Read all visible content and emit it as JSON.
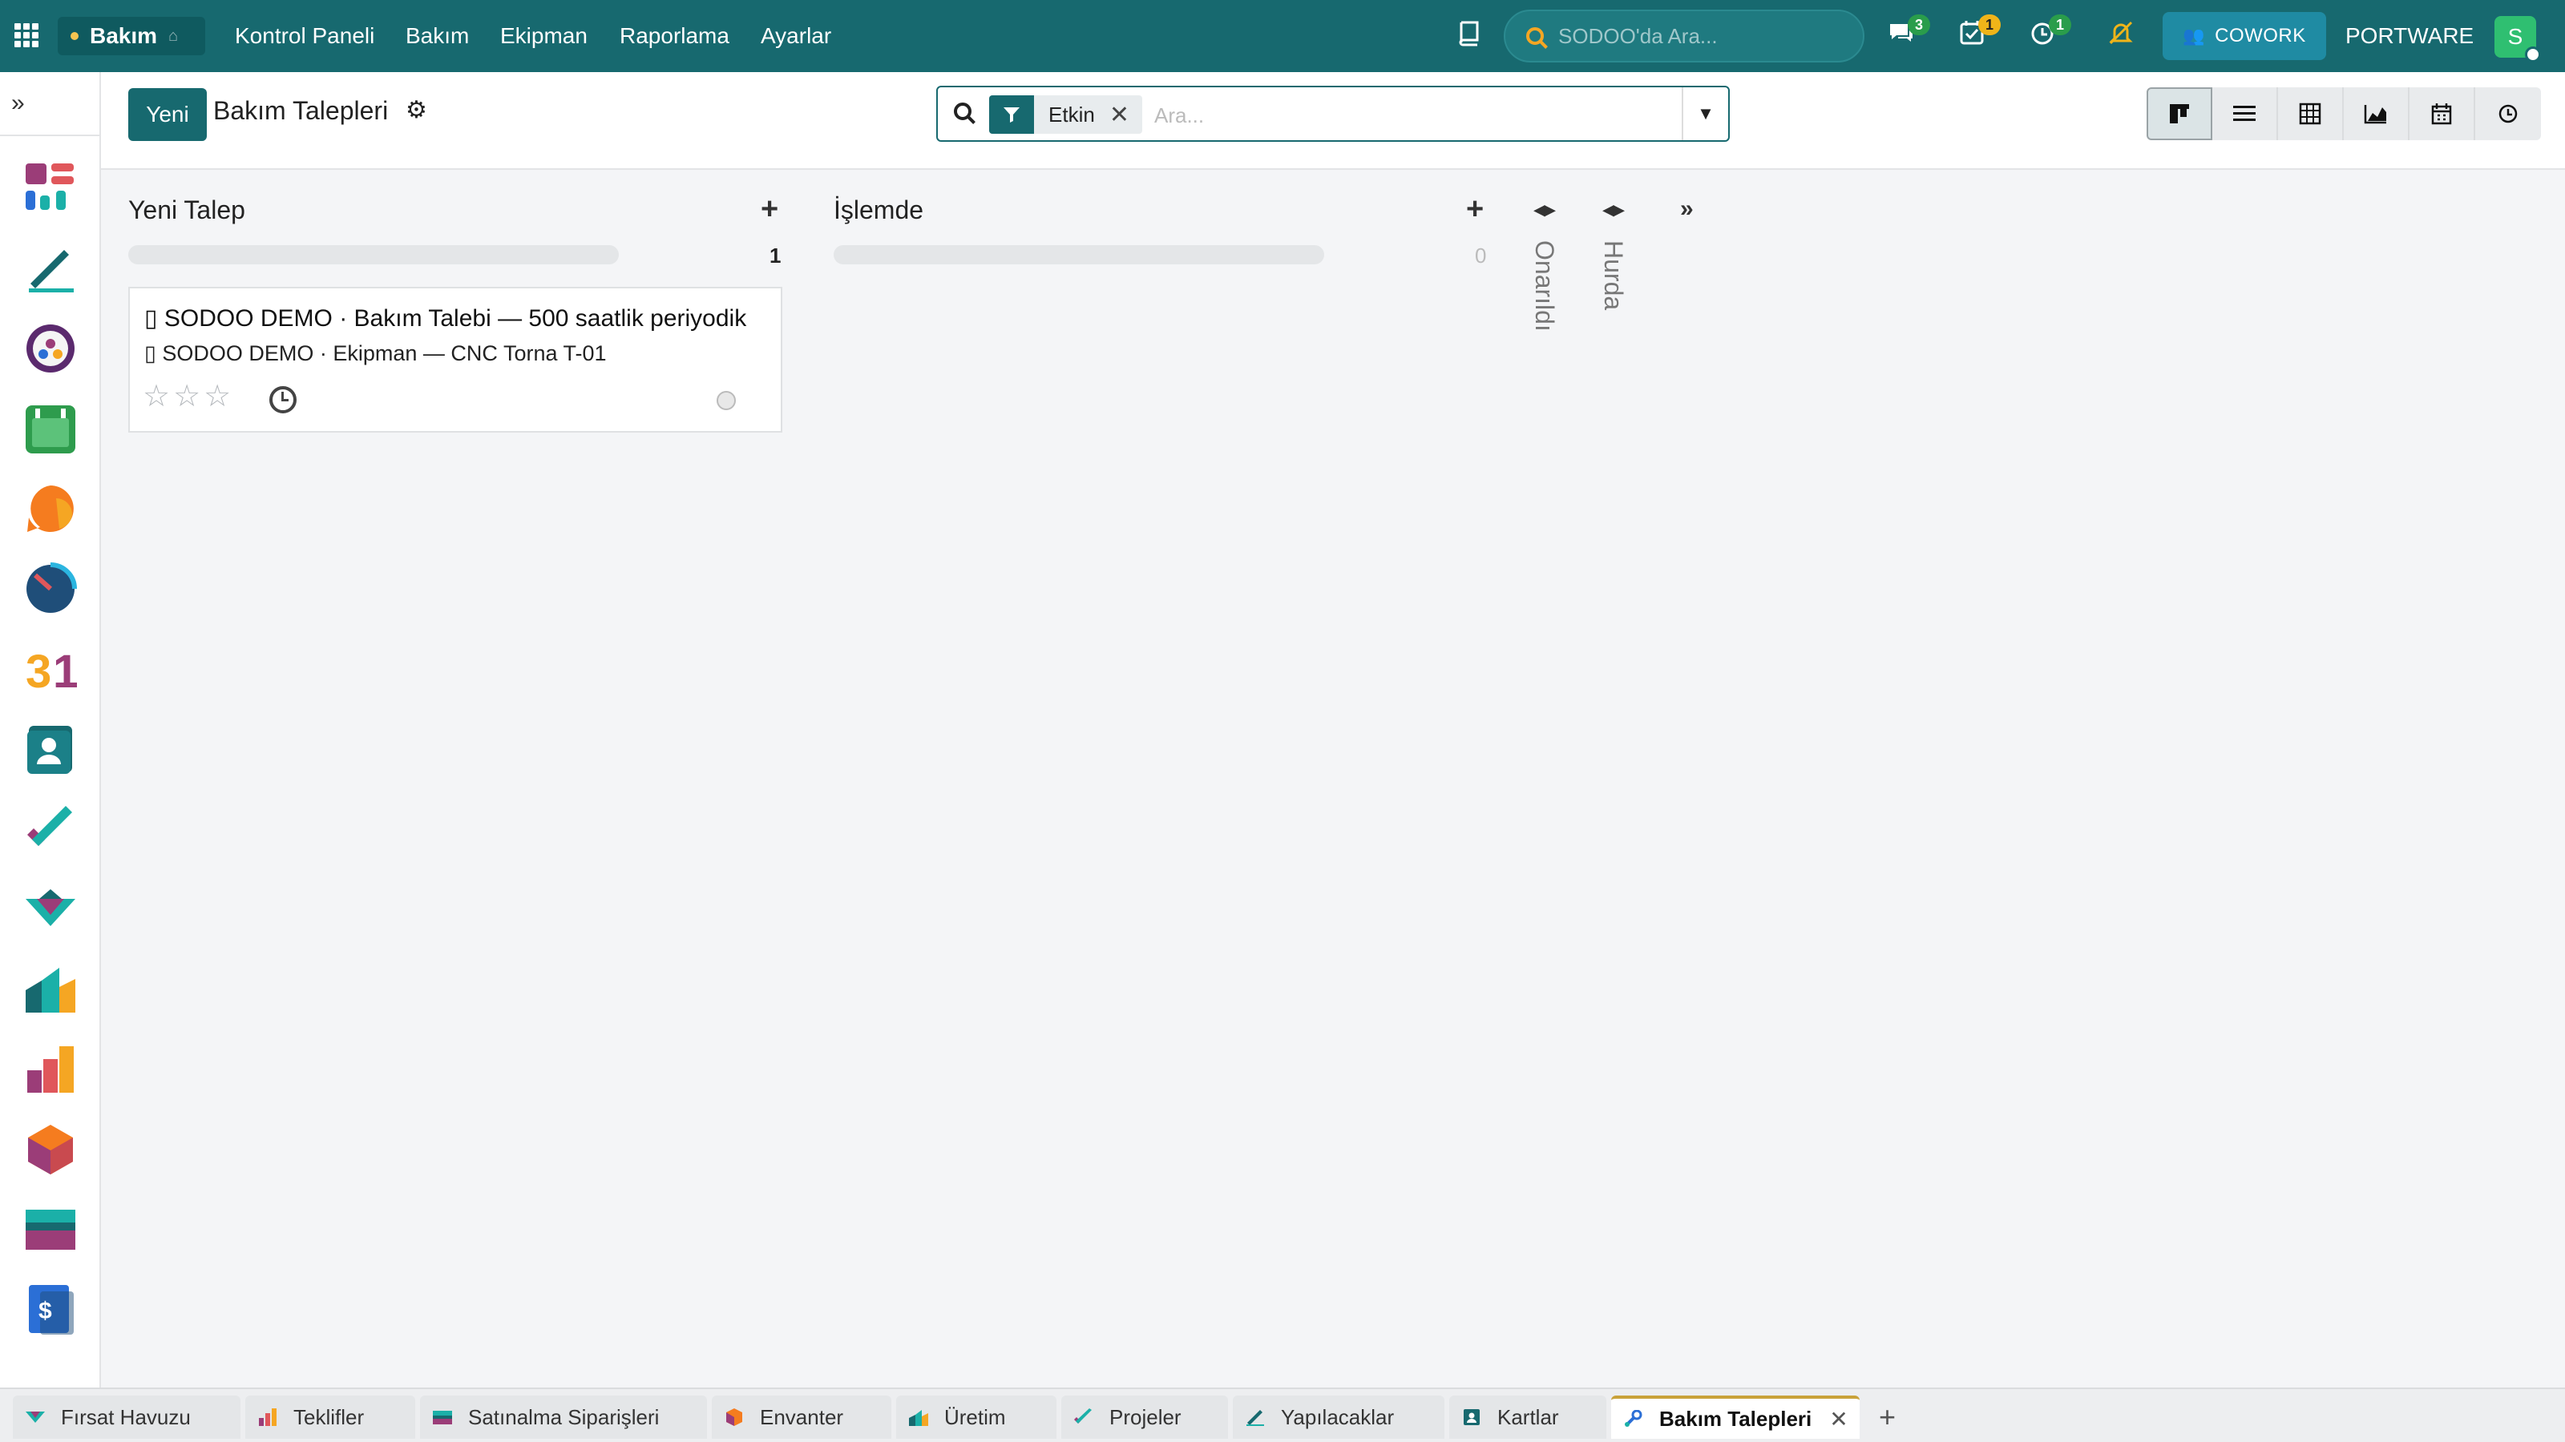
{
  "topbar": {
    "app_name": "Bakım",
    "menu": [
      "Kontrol Paneli",
      "Bakım",
      "Ekipman",
      "Raporlama",
      "Ayarlar"
    ],
    "search_placeholder": "SODOO'da Ara...",
    "badges": {
      "messages": "3",
      "activities": "1",
      "timer": "1"
    },
    "cowork_label": "COWORK",
    "company": "PORTWARE",
    "user_initial": "S"
  },
  "control": {
    "new_button": "Yeni",
    "title": "Bakım Talepleri",
    "facet_label": "Etkin",
    "search_placeholder": "Ara..."
  },
  "kanban": {
    "columns": [
      {
        "title": "Yeni Talep",
        "count": "1"
      },
      {
        "title": "İşlemde",
        "count": "0"
      }
    ],
    "folded": [
      "Onarıldı",
      "Hurda"
    ],
    "card": {
      "line1": "SODOO DEMO · Bakım Talebi — 500 saatlik periyodik",
      "line2": "SODOO DEMO · Ekipman — CNC Torna T-01"
    }
  },
  "tabs": [
    {
      "label": "Fırsat Havuzu",
      "icon": "handshake-icon"
    },
    {
      "label": "Teklifler",
      "icon": "bar-chart-icon"
    },
    {
      "label": "Satınalma Siparişleri",
      "icon": "card-icon"
    },
    {
      "label": "Envanter",
      "icon": "box-icon"
    },
    {
      "label": "Üretim",
      "icon": "factory-icon"
    },
    {
      "label": "Projeler",
      "icon": "check-icon"
    },
    {
      "label": "Yapılacaklar",
      "icon": "pen-icon"
    },
    {
      "label": "Kartlar",
      "icon": "contact-icon"
    },
    {
      "label": "Bakım Talepleri",
      "icon": "wrench-icon"
    }
  ],
  "colors": {
    "brand": "#17696f",
    "accent_orange": "#f5a623",
    "badge_green": "#2a9d4b",
    "badge_yellow": "#f0b419"
  }
}
